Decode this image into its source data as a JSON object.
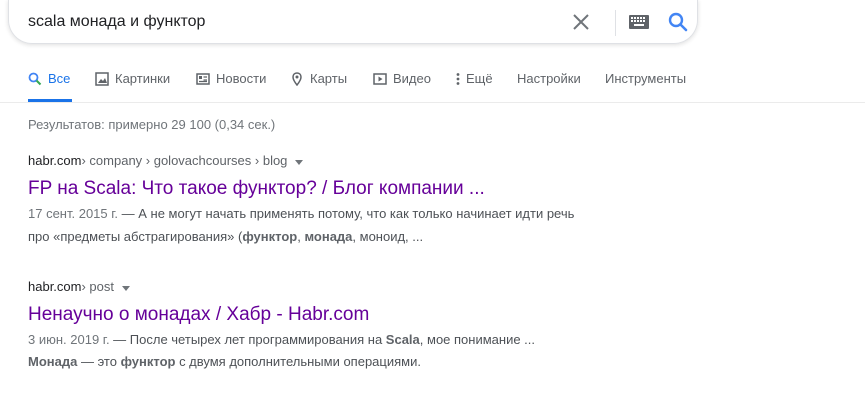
{
  "search": {
    "query": "scala монада и функтор",
    "clear_icon": "close-icon",
    "keyboard_icon": "keyboard-icon",
    "search_icon": "search-icon"
  },
  "tabs": [
    {
      "label": "Все",
      "icon": "search-icon",
      "active": true
    },
    {
      "label": "Картинки",
      "icon": "image-icon"
    },
    {
      "label": "Новости",
      "icon": "news-icon"
    },
    {
      "label": "Карты",
      "icon": "map-pin-icon"
    },
    {
      "label": "Видео",
      "icon": "video-icon"
    },
    {
      "label": "Ещё",
      "icon": "more-vert-icon"
    },
    {
      "label": "Настройки"
    },
    {
      "label": "Инструменты"
    }
  ],
  "stats": "Результатов: примерно 29 100 (0,34 сек.)",
  "results": [
    {
      "domain": "habr.com",
      "path": " › company › golovachcourses › blog",
      "title": "FP на Scala: Что такое функтор? / Блог компании ...",
      "date": "17 сент. 2015 г.",
      "line1": " — А не могут начать применять потому, что как только начинает идти речь",
      "line2_parts": [
        "про «предметы абстрагирования» (",
        "функтор",
        ", ",
        "монада",
        ", моноид, ..."
      ]
    },
    {
      "domain": "habr.com",
      "path": " › post",
      "title": "Ненаучно о монадах / Хабр - Habr.com",
      "date": "3 июн. 2019 г.",
      "line1_parts": [
        " — После четырех лет программирования на ",
        "Scala",
        ", мое понимание ..."
      ],
      "line2_parts": [
        "Монада",
        " — это ",
        "функтор",
        " с двумя дополнительными операциями."
      ]
    }
  ],
  "colors": {
    "accent": "#1a73e8",
    "visited_link": "#660099",
    "snippet": "#4d5156"
  }
}
